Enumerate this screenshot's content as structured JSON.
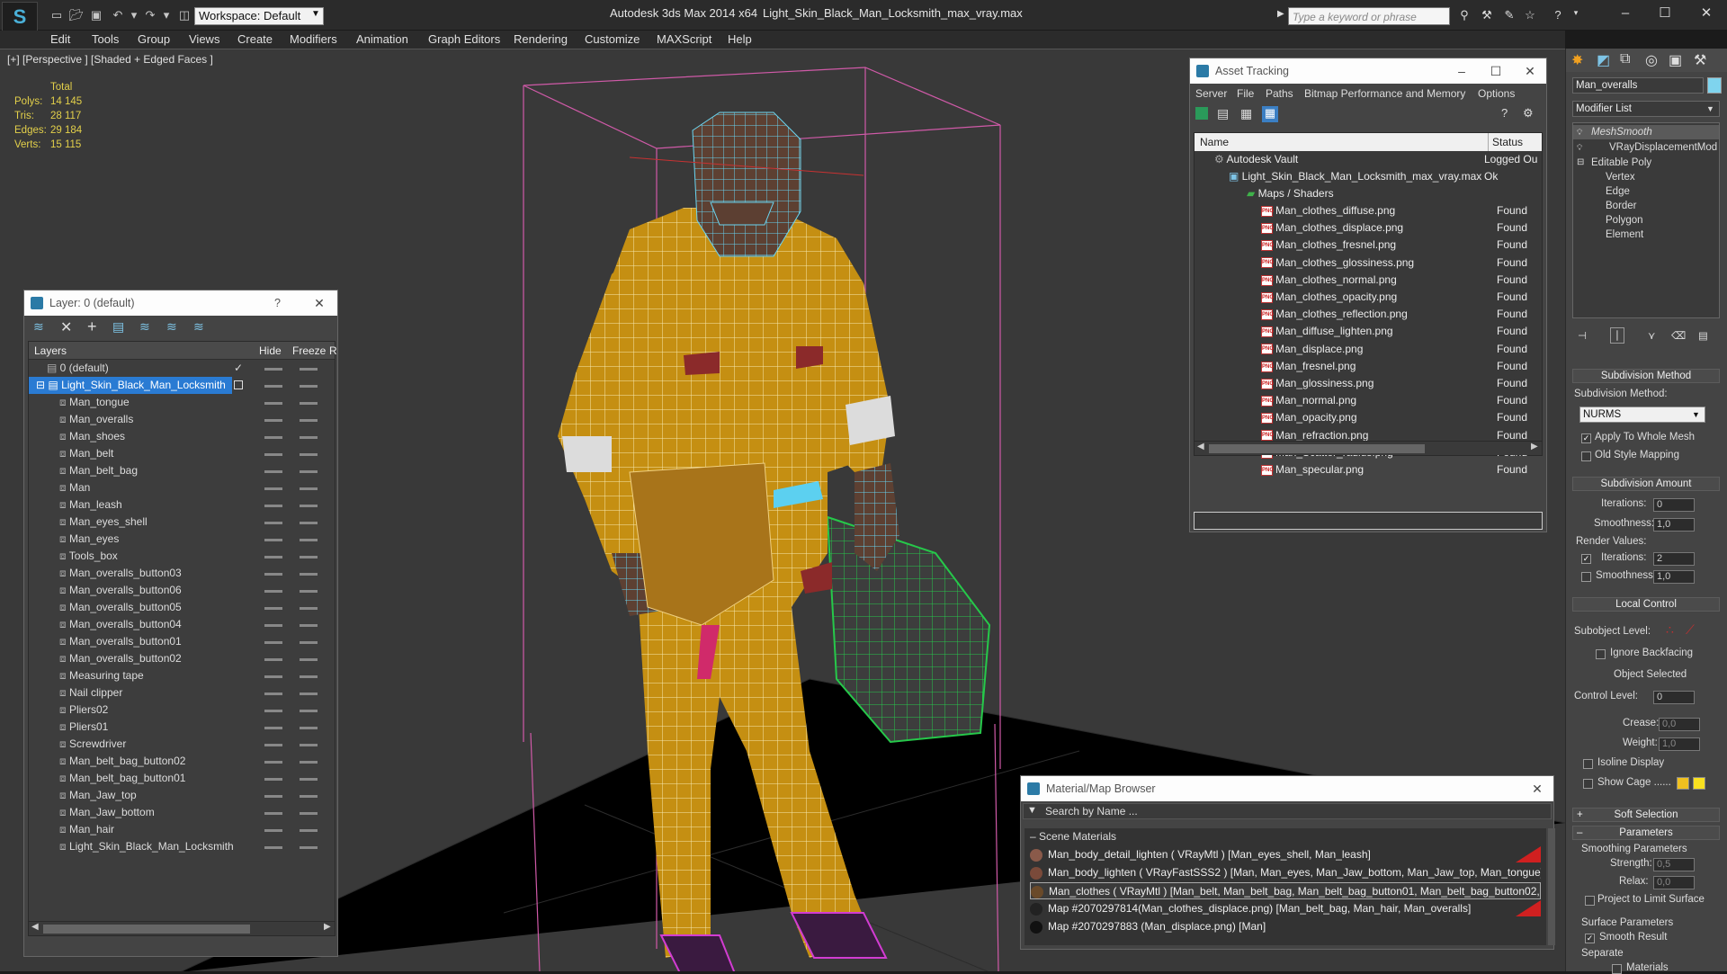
{
  "titlebar": {
    "logo": "S",
    "workspace": "Workspace: Default",
    "app": "Autodesk 3ds Max  2014 x64",
    "document": "Light_Skin_Black_Man_Locksmith_max_vray.max",
    "search_placeholder": "Type a keyword or phrase"
  },
  "menu": [
    "Edit",
    "Tools",
    "Group",
    "Views",
    "Create",
    "Modifiers",
    "Animation",
    "Graph Editors",
    "Rendering",
    "Customize",
    "MAXScript",
    "Help"
  ],
  "viewport": {
    "label": "[+] [Perspective ] [Shaded + Edged Faces ]",
    "stats_header": "Total",
    "stats": [
      {
        "label": "Polys:",
        "value": "14 145"
      },
      {
        "label": "Tris:",
        "value": "28 117"
      },
      {
        "label": "Edges:",
        "value": "29 184"
      },
      {
        "label": "Verts:",
        "value": "15 115"
      }
    ]
  },
  "layer_window": {
    "title": "Layer: 0 (default)",
    "help": "?",
    "close": "✕",
    "col_layers": "Layers",
    "col_hide": "Hide",
    "col_freeze": "Freeze",
    "col_r": "R",
    "default_layer": "0 (default)",
    "selected_layer": "Light_Skin_Black_Man_Locksmith",
    "objects": [
      "Man_tongue",
      "Man_overalls",
      "Man_shoes",
      "Man_belt",
      "Man_belt_bag",
      "Man",
      "Man_leash",
      "Man_eyes_shell",
      "Man_eyes",
      "Tools_box",
      "Man_overalls_button03",
      "Man_overalls_button06",
      "Man_overalls_button05",
      "Man_overalls_button04",
      "Man_overalls_button01",
      "Man_overalls_button02",
      "Measuring tape",
      "Nail clipper",
      "Pliers02",
      "Pliers01",
      "Screwdriver",
      "Man_belt_bag_button02",
      "Man_belt_bag_button01",
      "Man_Jaw_top",
      "Man_Jaw_bottom",
      "Man_hair",
      "Light_Skin_Black_Man_Locksmith"
    ]
  },
  "asset_window": {
    "title": "Asset Tracking",
    "menu": [
      "Server",
      "File",
      "Paths",
      "Bitmap Performance and Memory",
      "Options"
    ],
    "col_name": "Name",
    "col_status": "Status",
    "vault": "Autodesk Vault",
    "vault_status": "Logged Ou",
    "maxfile": "Light_Skin_Black_Man_Locksmith_max_vray.max",
    "maxfile_status": "Ok",
    "maps_folder": "Maps / Shaders",
    "files": [
      "Man_clothes_diffuse.png",
      "Man_clothes_displace.png",
      "Man_clothes_fresnel.png",
      "Man_clothes_glossiness.png",
      "Man_clothes_normal.png",
      "Man_clothes_opacity.png",
      "Man_clothes_reflection.png",
      "Man_diffuse_lighten.png",
      "Man_displace.png",
      "Man_fresnel.png",
      "Man_glossiness.png",
      "Man_normal.png",
      "Man_opacity.png",
      "Man_refraction.png",
      "Man_Scatter_radius.png",
      "Man_specular.png"
    ],
    "file_status": "Found"
  },
  "material_browser": {
    "title": "Material/Map Browser",
    "search": "Search by Name ...",
    "section": "Scene Materials",
    "items": [
      "Man_body_detail_lighten ( VRayMtl ) [Man_eyes_shell, Man_leash]",
      "Man_body_lighten ( VRayFastSSS2 ) [Man, Man_eyes, Man_Jaw_bottom, Man_Jaw_top, Man_tongue]",
      "Man_clothes ( VRayMtl ) [Man_belt, Man_belt_bag, Man_belt_bag_button01, Man_belt_bag_button02,...",
      "Map #2070297814(Man_clothes_displace.png) [Man_belt_bag, Man_hair, Man_overalls]",
      "Map #2070297883 (Man_displace.png) [Man]"
    ]
  },
  "command_panel": {
    "object_name": "Man_overalls",
    "object_color": "#7fd4ee",
    "modifier_list": "Modifier List",
    "stack": [
      "MeshSmooth",
      "VRayDisplacementMod",
      "Editable Poly",
      "Vertex",
      "Edge",
      "Border",
      "Polygon",
      "Element"
    ],
    "subdiv_method_hdr": "Subdivision Method",
    "subdiv_method_label": "Subdivision Method:",
    "subdiv_method_value": "NURMS",
    "apply_whole": "Apply To Whole Mesh",
    "old_style": "Old Style Mapping",
    "subdiv_amount_hdr": "Subdivision Amount",
    "iterations_label": "Iterations:",
    "iterations": "0",
    "smoothness_label": "Smoothness:",
    "smoothness": "1,0",
    "render_values": "Render Values:",
    "r_iterations_label": "Iterations:",
    "r_iterations": "2",
    "r_smoothness_label": "Smoothness:",
    "r_smoothness": "1,0",
    "local_control_hdr": "Local Control",
    "subobject_level": "Subobject Level:",
    "ignore_backfacing": "Ignore Backfacing",
    "object_selected": "Object Selected",
    "control_level_label": "Control Level:",
    "control_level": "0",
    "crease_label": "Crease:",
    "crease": "0,0",
    "weight_label": "Weight:",
    "weight": "1,0",
    "isoline": "Isoline Display",
    "show_cage": "Show Cage ......",
    "soft_selection_hdr": "Soft Selection",
    "parameters_hdr": "Parameters",
    "smoothing_params": "Smoothing Parameters",
    "strength_label": "Strength:",
    "strength": "0,5",
    "relax_label": "Relax:",
    "relax": "0,0",
    "project_limit": "Project to Limit Surface",
    "surface_params": "Surface Parameters",
    "smooth_result": "Smooth Result",
    "separate": "Separate",
    "materials": "Materials"
  }
}
